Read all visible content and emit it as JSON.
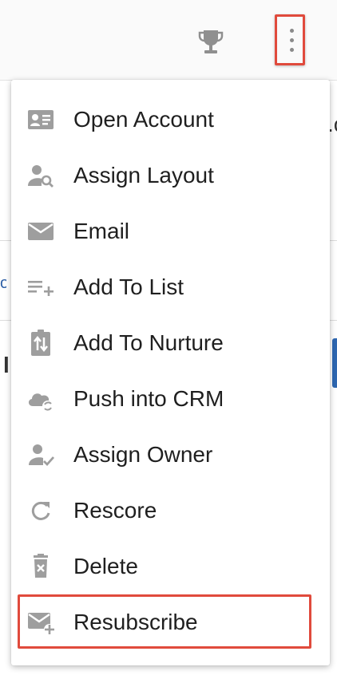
{
  "menu": {
    "items": [
      {
        "label": "Open Account",
        "icon": "contact-card-icon"
      },
      {
        "label": "Assign Layout",
        "icon": "person-search-icon"
      },
      {
        "label": "Email",
        "icon": "envelope-icon"
      },
      {
        "label": "Add To List",
        "icon": "list-add-icon"
      },
      {
        "label": "Add To Nurture",
        "icon": "nurture-icon"
      },
      {
        "label": "Push into CRM",
        "icon": "cloud-sync-icon"
      },
      {
        "label": "Assign Owner",
        "icon": "person-check-icon"
      },
      {
        "label": "Rescore",
        "icon": "refresh-icon"
      },
      {
        "label": "Delete",
        "icon": "trash-icon"
      },
      {
        "label": "Resubscribe",
        "icon": "mail-plus-icon"
      }
    ]
  },
  "colors": {
    "highlight": "#e04a3c",
    "icon": "#9e9e9e",
    "text": "#1f1f1f",
    "link": "#2d5fa6",
    "accent_blue": "#2e67b1"
  },
  "background": {
    "fragment_right": ".c",
    "fragment_left": "l",
    "fragment_link": "oc"
  }
}
